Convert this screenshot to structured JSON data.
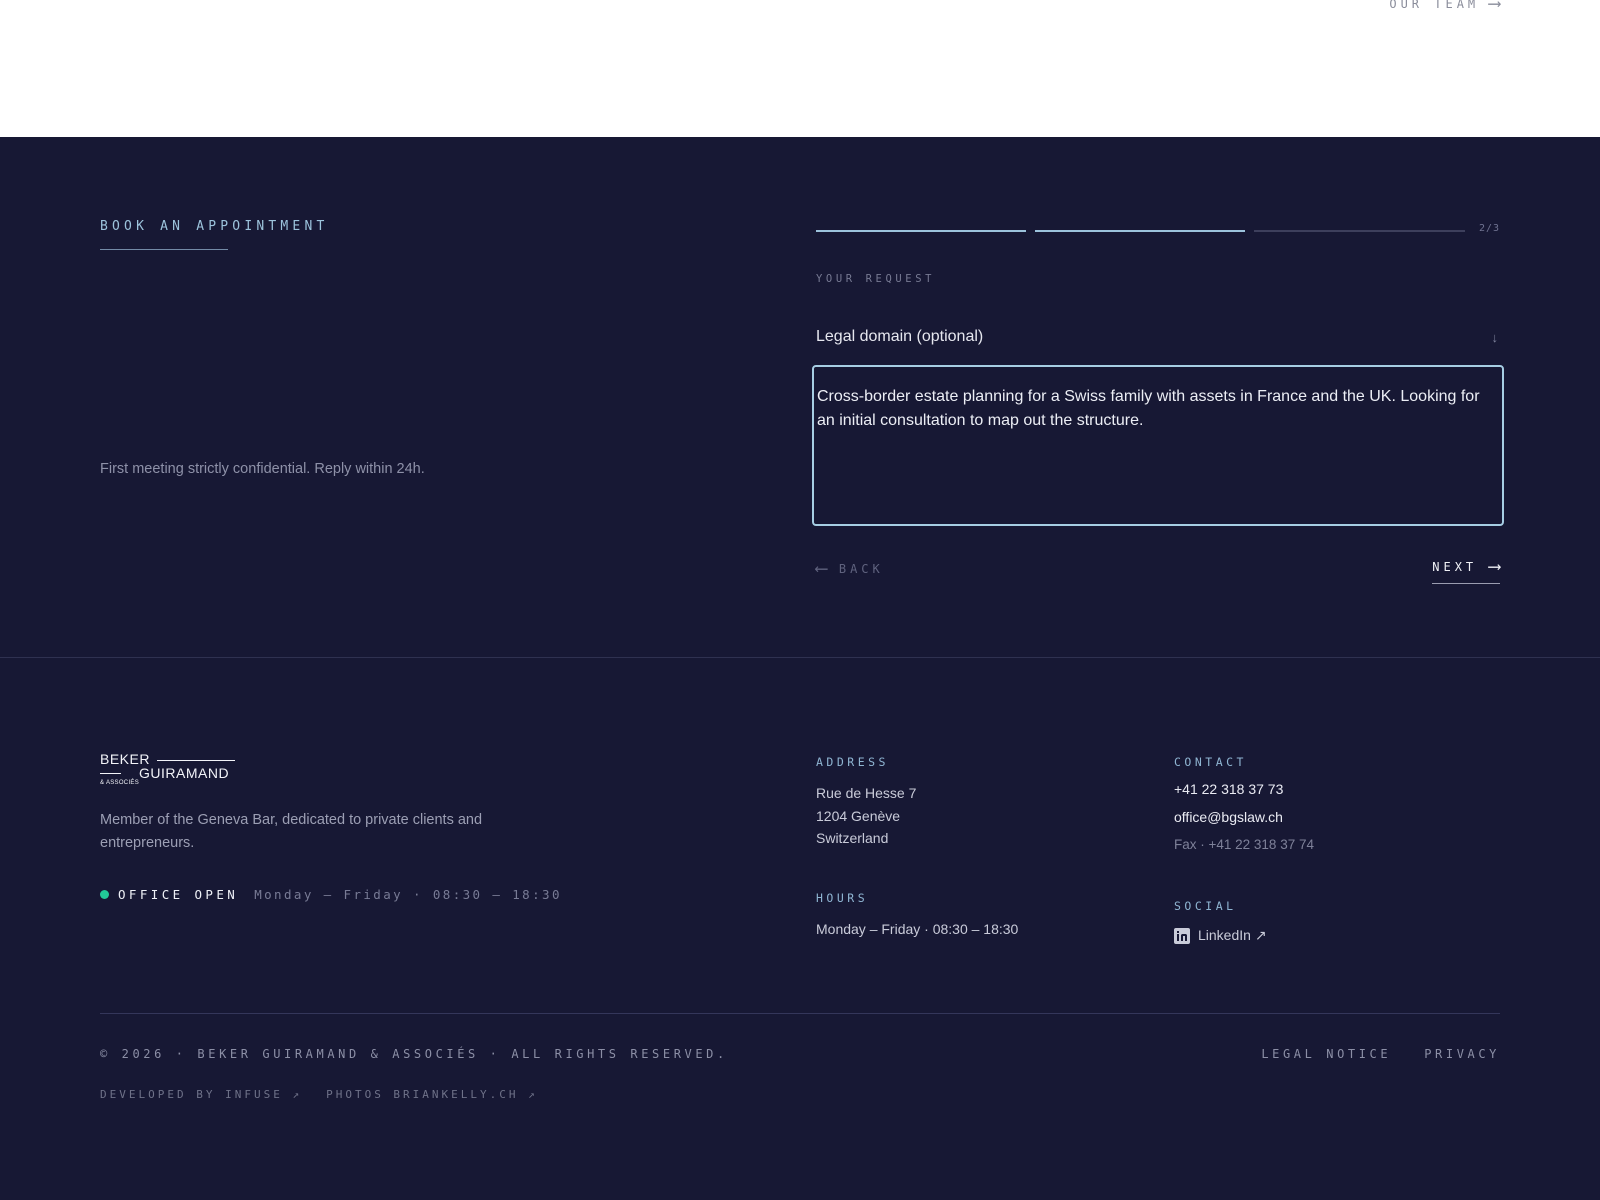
{
  "top": {
    "team_link": "OUR TEAM",
    "team_arrow": "⟶"
  },
  "booking": {
    "title": "BOOK AN APPOINTMENT",
    "confidential": "First meeting strictly confidential. Reply within 24h.",
    "progress": {
      "current": 2,
      "total": 3,
      "label": "2/3"
    },
    "section_label": "YOUR REQUEST",
    "legal_domain": {
      "value": "Legal domain (optional)",
      "arrow": "↓"
    },
    "message": "Cross-border estate planning for a Swiss family with assets in France and the UK. Looking for an initial consultation to map out the structure.",
    "back": {
      "label": "BACK",
      "arrow": "⟵"
    },
    "next": {
      "label": "NEXT",
      "arrow": "⟶"
    }
  },
  "footer": {
    "logo": {
      "line1": "BEKER",
      "line2": "GUIRAMAND",
      "line3": "& ASSOCIÉS"
    },
    "about": "Member of the Geneva Bar, dedicated to private clients and entrepreneurs.",
    "office_status": "OFFICE OPEN",
    "office_hours": "Monday – Friday · 08:30 – 18:30",
    "address": {
      "title": "ADDRESS",
      "line1": "Rue de Hesse 7",
      "line2": "1204 Genève",
      "line3": "Switzerland"
    },
    "hours": {
      "title": "HOURS",
      "text": "Monday – Friday · 08:30 – 18:30"
    },
    "contact": {
      "title": "CONTACT",
      "phone": "+41 22 318 37 73",
      "email": "office@bgslaw.ch",
      "fax": "Fax · +41 22 318 37 74"
    },
    "social": {
      "title": "SOCIAL",
      "linkedin": "LinkedIn ↗",
      "icon": "linkedin-icon"
    },
    "copyright": "© 2026 · BEKER GUIRAMAND & ASSOCIÉS · ALL RIGHTS RESERVED.",
    "legal_notice": "LEGAL NOTICE",
    "privacy": "PRIVACY",
    "developed_by": "DEVELOPED BY INFUSE ↗",
    "photos": "PHOTOS BRIANKELLY.CH ↗"
  },
  "colors": {
    "background_dark": "#171834",
    "accent": "#9cc3dc",
    "status_green": "#22c997"
  }
}
